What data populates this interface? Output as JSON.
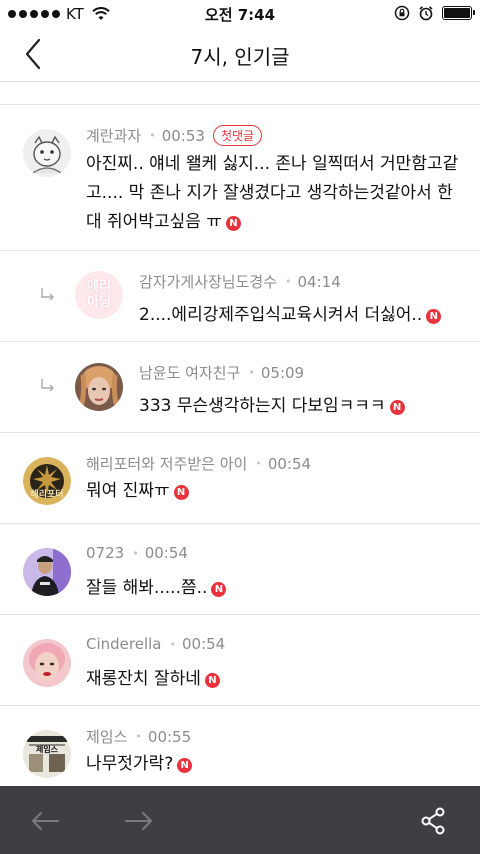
{
  "status_bar": {
    "carrier": "KT",
    "time": "오전 7:44"
  },
  "nav": {
    "title": "7시, 인기글",
    "back_icon": "chevron-left-icon"
  },
  "comments": [
    {
      "user": "계란과자",
      "time": "00:53",
      "badge": "첫댓글",
      "text": "아진찌.. 얘네 왤케 싫지... 존나 일찍떠서 거만함고같고.... 막 존나 지가 잘생겼다고 생각하는것같아서 한대 쥐어박고싶음 ㅠ",
      "is_reply": false
    },
    {
      "user": "감자가게사장님도경수",
      "time": "04:14",
      "text": "2....에리강제주입식교육시켜서 더싫어..",
      "is_reply": true,
      "avatar_text": "에리\n아님"
    },
    {
      "user": "남윤도 여자친구",
      "time": "05:09",
      "text": "333 무슨생각하는지 다보임ㅋㅋㅋ",
      "is_reply": true
    },
    {
      "user": "해리포터와 저주받은 아이",
      "time": "00:54",
      "text": "뭐여 진짜ㅠ",
      "is_reply": false,
      "avatar_text": "해리포터"
    },
    {
      "user": "0723",
      "time": "00:54",
      "text": "잘들 해봐.....쯤..",
      "is_reply": false
    },
    {
      "user": "Cinderella",
      "time": "00:54",
      "text": "재롱잔치 잘하네",
      "is_reply": false
    },
    {
      "user": "제임스",
      "time": "00:55",
      "text": "나무젓가락?",
      "is_reply": false,
      "avatar_text": "제임스"
    }
  ],
  "new_badge": "N",
  "toolbar": {
    "back_icon": "arrow-left-icon",
    "forward_icon": "arrow-right-icon",
    "share_icon": "share-icon"
  },
  "colors": {
    "accent_red": "#e8333c",
    "toolbar_bg": "#3e3f44",
    "meta_gray": "#8c8c8c"
  }
}
